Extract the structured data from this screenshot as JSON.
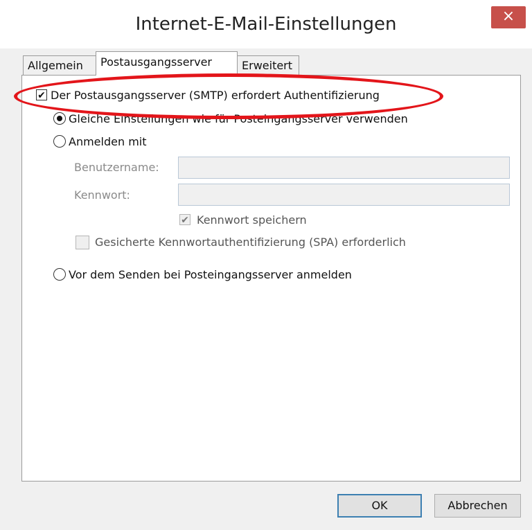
{
  "window": {
    "title": "Internet-E-Mail-Einstellungen",
    "close_symbol": "×"
  },
  "tabs": [
    {
      "label": "Allgemein",
      "active": false
    },
    {
      "label": "Postausgangsserver",
      "active": true
    },
    {
      "label": "Erweitert",
      "active": false
    }
  ],
  "auth": {
    "requires_auth_label": "Der Postausgangsserver (SMTP) erfordert Authentifizierung",
    "requires_auth_checked": true,
    "same_settings_label": "Gleiche Einstellungen wie für Posteingangsserver verwenden",
    "login_with_label": "Anmelden mit",
    "username_label": "Benutzername:",
    "username_value": "",
    "password_label": "Kennwort:",
    "password_value": "",
    "save_password_label": "Kennwort speichern",
    "save_password_checked": true,
    "spa_label": "Gesicherte Kennwortauthentifizierung (SPA) erforderlich",
    "spa_checked": false,
    "login_before_send_label": "Vor dem Senden bei Posteingangsserver anmelden",
    "selected_option": "same_settings"
  },
  "buttons": {
    "ok": "OK",
    "cancel": "Abbrechen"
  },
  "colors": {
    "close": "#c7504a",
    "highlight_oval": "#e3151a",
    "default_button_border": "#3c7fb1"
  }
}
